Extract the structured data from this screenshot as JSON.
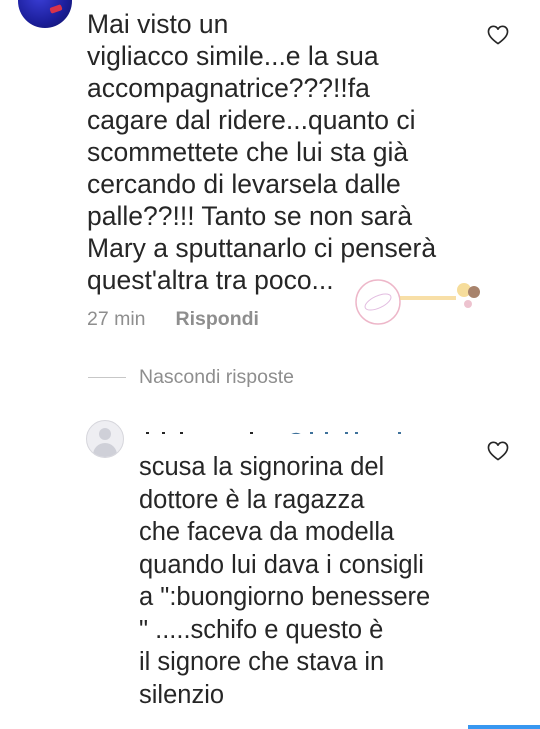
{
  "comment1": {
    "text": "Mai visto un\nvigliacco simile...e la sua\naccompagnatrice???!!fa\ncagare dal ridere...quanto ci\nscommettete che lui sta già\ncercando di levarsela dalle\npalle??!!! Tanto se non sarà\nMary a sputtanarlo ci penserà\nquest'altra tra poco...",
    "time": "27 min",
    "reply_label": "Rispondi"
  },
  "hide_replies_label": "Nascondi risposte",
  "reply1": {
    "text": "scusa  la signorina del\ndottore è  la ragazza\nche faceva da modella\nquando  lui dava i consigli\na \":buongiorno benessere\n\" .....schifo e questo è\nil signore  che stava in\nsilenzio"
  },
  "colors": {
    "text": "#262626",
    "secondary": "#8e8e8e",
    "accent": "#3897f0",
    "avatar": "#1b1e9a"
  },
  "icons": [
    "heart-outline-icon",
    "avatar-placeholder-icon"
  ]
}
